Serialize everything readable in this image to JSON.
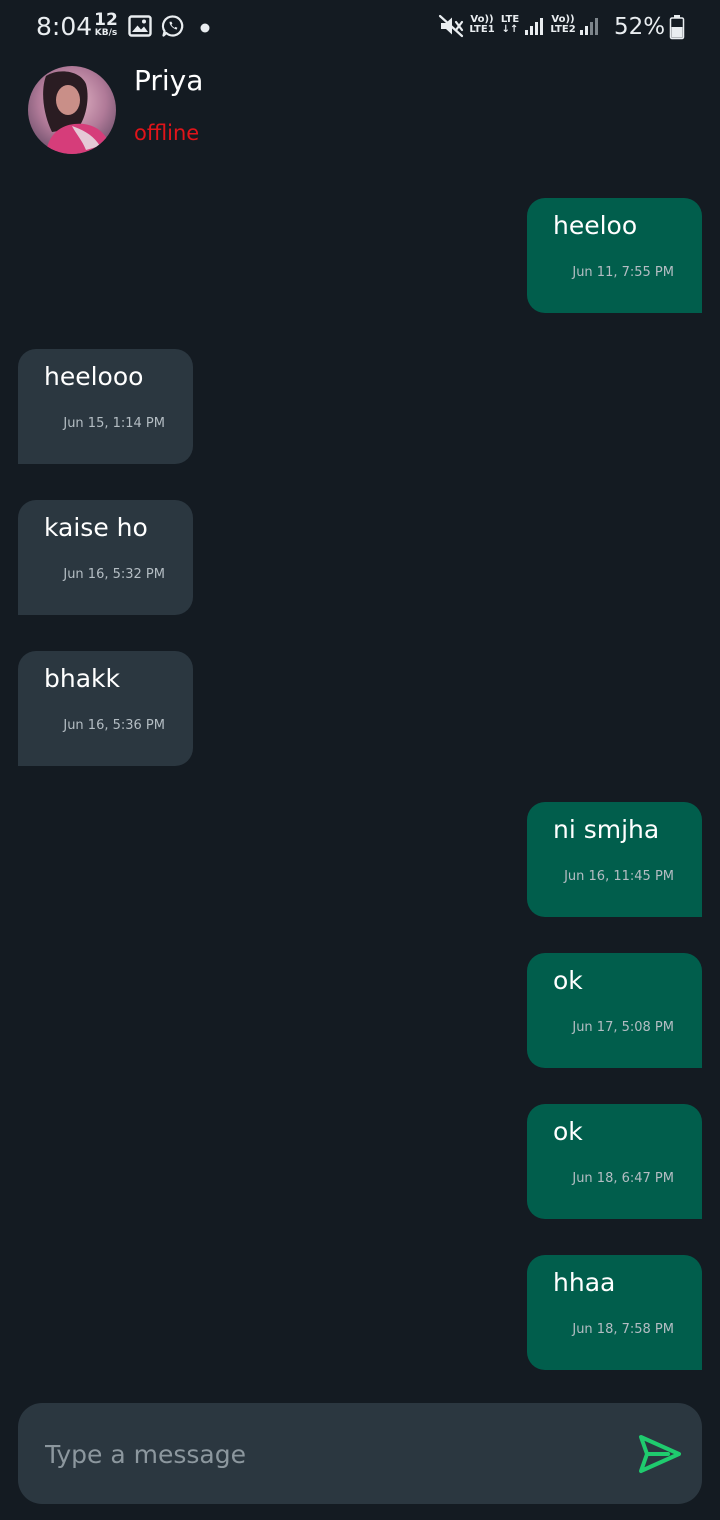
{
  "status_bar": {
    "time": "8:04",
    "net_speed_value": "12",
    "net_speed_unit": "KB/s",
    "sim1_top": "Vo))",
    "sim1_bottom": "LTE1",
    "lte_label": "LTE",
    "sim2_top": "Vo))",
    "sim2_bottom": "LTE2",
    "battery": "52%",
    "icons": [
      "gallery-icon",
      "whatsapp-icon",
      "dot-icon",
      "mute-icon",
      "signal-icon",
      "battery-icon"
    ]
  },
  "header": {
    "contact_name": "Priya",
    "status": "offline",
    "status_color": "#e0141a"
  },
  "messages": [
    {
      "direction": "sent",
      "text": "heeloo",
      "time": "Jun 11, 7:55 PM"
    },
    {
      "direction": "received",
      "text": "heelooo",
      "time": "Jun 15, 1:14 PM"
    },
    {
      "direction": "received",
      "text": "kaise ho",
      "time": "Jun 16, 5:32 PM"
    },
    {
      "direction": "received",
      "text": "bhakk",
      "time": "Jun 16, 5:36 PM"
    },
    {
      "direction": "sent",
      "text": "ni smjha",
      "time": "Jun 16, 11:45 PM"
    },
    {
      "direction": "sent",
      "text": "ok",
      "time": "Jun 17, 5:08 PM"
    },
    {
      "direction": "sent",
      "text": "ok",
      "time": "Jun 18, 6:47 PM"
    },
    {
      "direction": "sent",
      "text": "hhaa",
      "time": "Jun 18, 7:58 PM"
    }
  ],
  "composer": {
    "placeholder": "Type a message",
    "value": "",
    "send_icon": "send-icon",
    "send_color": "#1fcb6e"
  },
  "colors": {
    "background": "#141b22",
    "sent_bubble": "#015e4c",
    "received_bubble": "#2b3740"
  }
}
